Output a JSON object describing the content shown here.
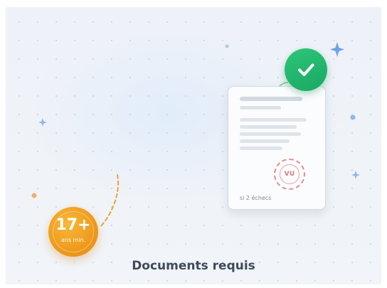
{
  "document_card": {
    "stamp_text": "VU",
    "note": "si 2 échecs"
  },
  "age_badge": {
    "value": "17+",
    "caption": "ans min."
  },
  "section_title": "Documents requis",
  "colors": {
    "check_green": "#1fb56d",
    "badge_orange": "#ee9a1c",
    "stamp_red": "#e58c8c",
    "sparkle_blue": "#6fa4e8",
    "title_text": "#3f4a5a"
  },
  "icons": [
    "checkmark-icon",
    "sparkle-icon",
    "stamp-icon"
  ]
}
